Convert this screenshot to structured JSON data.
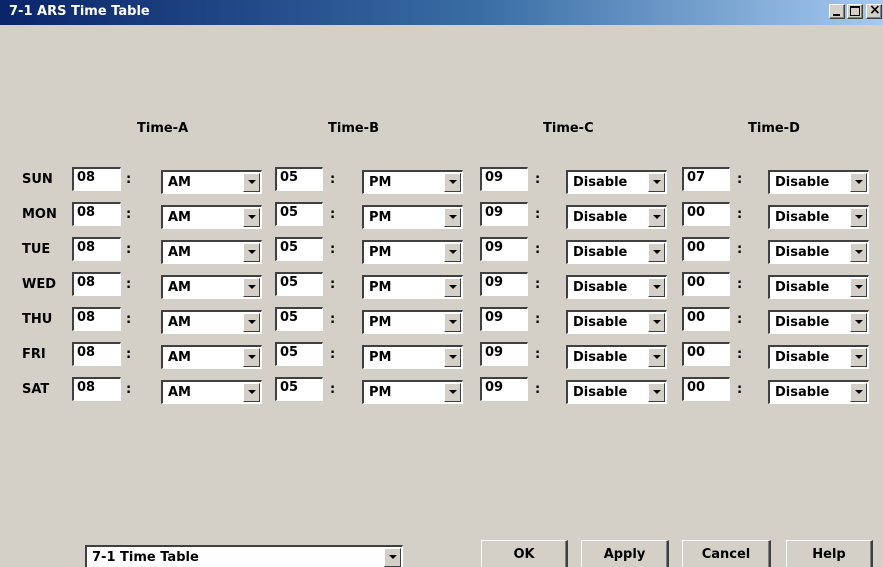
{
  "window": {
    "title": "7-1 ARS Time Table"
  },
  "columns": [
    "Time-A",
    "Time-B",
    "Time-C",
    "Time-D"
  ],
  "rows": [
    {
      "day": "SUN",
      "cells": [
        {
          "hour": "08",
          "sel": "AM"
        },
        {
          "hour": "05",
          "sel": "PM"
        },
        {
          "hour": "09",
          "sel": "Disable"
        },
        {
          "hour": "07",
          "sel": "Disable"
        }
      ]
    },
    {
      "day": "MON",
      "cells": [
        {
          "hour": "08",
          "sel": "AM"
        },
        {
          "hour": "05",
          "sel": "PM"
        },
        {
          "hour": "09",
          "sel": "Disable"
        },
        {
          "hour": "00",
          "sel": "Disable"
        }
      ]
    },
    {
      "day": "TUE",
      "cells": [
        {
          "hour": "08",
          "sel": "AM"
        },
        {
          "hour": "05",
          "sel": "PM"
        },
        {
          "hour": "09",
          "sel": "Disable"
        },
        {
          "hour": "00",
          "sel": "Disable"
        }
      ]
    },
    {
      "day": "WED",
      "cells": [
        {
          "hour": "08",
          "sel": "AM"
        },
        {
          "hour": "05",
          "sel": "PM"
        },
        {
          "hour": "09",
          "sel": "Disable"
        },
        {
          "hour": "00",
          "sel": "Disable"
        }
      ]
    },
    {
      "day": "THU",
      "cells": [
        {
          "hour": "08",
          "sel": "AM"
        },
        {
          "hour": "05",
          "sel": "PM"
        },
        {
          "hour": "09",
          "sel": "Disable"
        },
        {
          "hour": "00",
          "sel": "Disable"
        }
      ]
    },
    {
      "day": "FRI",
      "cells": [
        {
          "hour": "08",
          "sel": "AM"
        },
        {
          "hour": "05",
          "sel": "PM"
        },
        {
          "hour": "09",
          "sel": "Disable"
        },
        {
          "hour": "00",
          "sel": "Disable"
        }
      ]
    },
    {
      "day": "SAT",
      "cells": [
        {
          "hour": "08",
          "sel": "AM"
        },
        {
          "hour": "05",
          "sel": "PM"
        },
        {
          "hour": "09",
          "sel": "Disable"
        },
        {
          "hour": "00",
          "sel": "Disable"
        }
      ]
    }
  ],
  "colon": ":",
  "footer": {
    "table_select": "7-1 Time Table",
    "buttons": {
      "ok": "OK",
      "apply": "Apply",
      "cancel": "Cancel",
      "help": "Help"
    }
  }
}
